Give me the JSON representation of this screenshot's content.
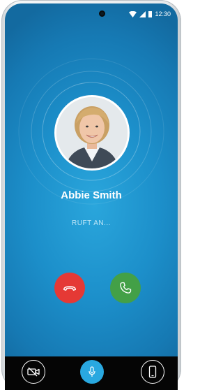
{
  "status_bar": {
    "time": "12:30",
    "icons": [
      "wifi-icon",
      "cellular-signal-icon",
      "battery-icon"
    ]
  },
  "caller": {
    "name": "Abbie Smith",
    "status": "RUFT AN..."
  },
  "actions": {
    "decline_icon": "phone-hangup-icon",
    "accept_icon": "phone-answer-icon"
  },
  "bottom_bar": {
    "left_icon": "video-off-icon",
    "center_icon": "microphone-icon",
    "right_icon": "mobile-device-icon"
  },
  "colors": {
    "background": "#1c8fca",
    "decline": "#e53935",
    "accept": "#43a047",
    "mic_active": "#29a8e0"
  }
}
